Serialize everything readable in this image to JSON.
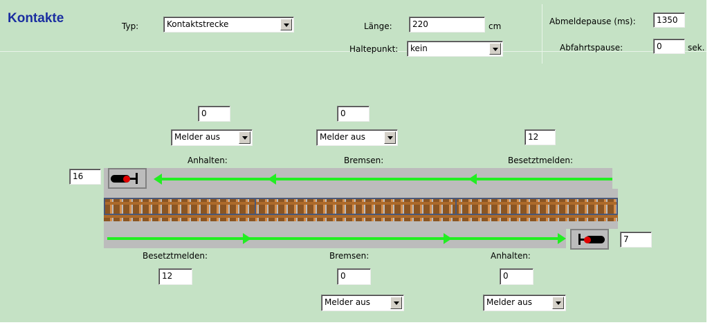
{
  "header": {
    "title": "Kontakte",
    "typ_label": "Typ:",
    "typ_value": "Kontaktstrecke",
    "laenge_label": "Länge:",
    "laenge_value": "220",
    "laenge_unit": "cm",
    "haltepunkt_label": "Haltepunkt:",
    "haltepunkt_value": "kein",
    "abmeldepause_label": "Abmeldepause (ms):",
    "abmeldepause_value": "1350",
    "abfahrtspause_label": "Abfahrtspause:",
    "abfahrtspause_value": "0",
    "abfahrtspause_unit": "sek."
  },
  "top_direction": {
    "anhalten": {
      "label": "Anhalten:",
      "value": "0",
      "melder": "Melder aus"
    },
    "bremsen": {
      "label": "Bremsen:",
      "value": "0",
      "melder": "Melder aus"
    },
    "besetztmelden": {
      "label": "Besetztmelden:",
      "value": "12"
    },
    "signal_value": "16"
  },
  "bottom_direction": {
    "besetztmelden": {
      "label": "Besetztmelden:",
      "value": "12"
    },
    "bremsen": {
      "label": "Bremsen:",
      "value": "0",
      "melder": "Melder aus"
    },
    "anhalten": {
      "label": "Anhalten:",
      "value": "0",
      "melder": "Melder aus"
    },
    "signal_value": "7"
  },
  "colors": {
    "panel_bg": "#c5e2c5",
    "title": "#1a2ea0",
    "arrow": "#22ee22",
    "signal_lamp": "#e00000"
  }
}
